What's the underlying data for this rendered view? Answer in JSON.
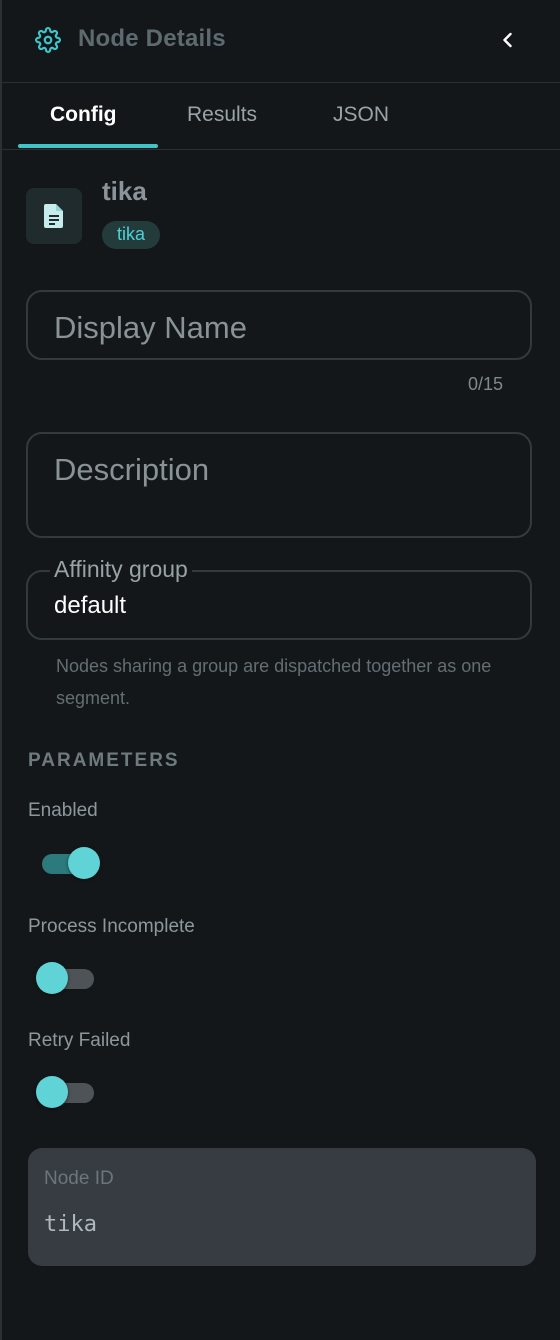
{
  "header": {
    "title": "Node Details",
    "settings_icon": "gear-icon",
    "back_icon": "chevron-left-icon"
  },
  "tabs": [
    {
      "label": "Config",
      "active": true
    },
    {
      "label": "Results",
      "active": false
    },
    {
      "label": "JSON",
      "active": false
    }
  ],
  "node": {
    "icon": "document-icon",
    "name": "tika",
    "type_badge": "tika"
  },
  "form": {
    "display_name": {
      "placeholder": "Display Name",
      "value": "",
      "counter": "0/15"
    },
    "description": {
      "placeholder": "Description",
      "value": ""
    },
    "affinity_group": {
      "label": "Affinity group",
      "value": "default",
      "hint": "Nodes sharing a group are dispatched together as one segment."
    }
  },
  "parameters": {
    "title": "PARAMETERS",
    "items": [
      {
        "label": "Enabled",
        "value": true
      },
      {
        "label": "Process Incomplete",
        "value": false
      },
      {
        "label": "Retry Failed",
        "value": false
      }
    ]
  },
  "node_id": {
    "label": "Node ID",
    "value": "tika"
  },
  "colors": {
    "accent": "#3fc5c9",
    "background": "#13171a",
    "toggle_knob": "#5fd3d6",
    "badge_bg": "#243b3c"
  }
}
